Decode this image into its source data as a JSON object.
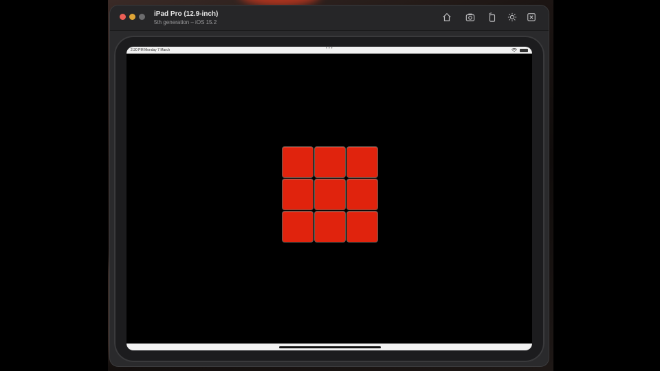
{
  "window": {
    "title": "iPad Pro (12.9-inch)",
    "subtitle": "5th generation – iOS 15.2"
  },
  "toolbar": {
    "icons": [
      "home-icon",
      "screenshot-icon",
      "rotate-icon",
      "appearance-icon",
      "close-app-icon"
    ]
  },
  "status_bar": {
    "time": "2:30 PM  Monday 7 March",
    "center_dots": "• • •"
  },
  "grid": {
    "rows": 3,
    "columns": 3,
    "tile_color": "#e0230d",
    "tiles": [
      {
        "id": "1"
      },
      {
        "id": "2"
      },
      {
        "id": "3"
      },
      {
        "id": "4"
      },
      {
        "id": "5"
      },
      {
        "id": "6"
      },
      {
        "id": "7"
      },
      {
        "id": "8"
      },
      {
        "id": "9"
      }
    ]
  },
  "colors": {
    "close": "#ec5f56",
    "minimize": "#e0a536",
    "zoom": "#6c6c6e"
  }
}
